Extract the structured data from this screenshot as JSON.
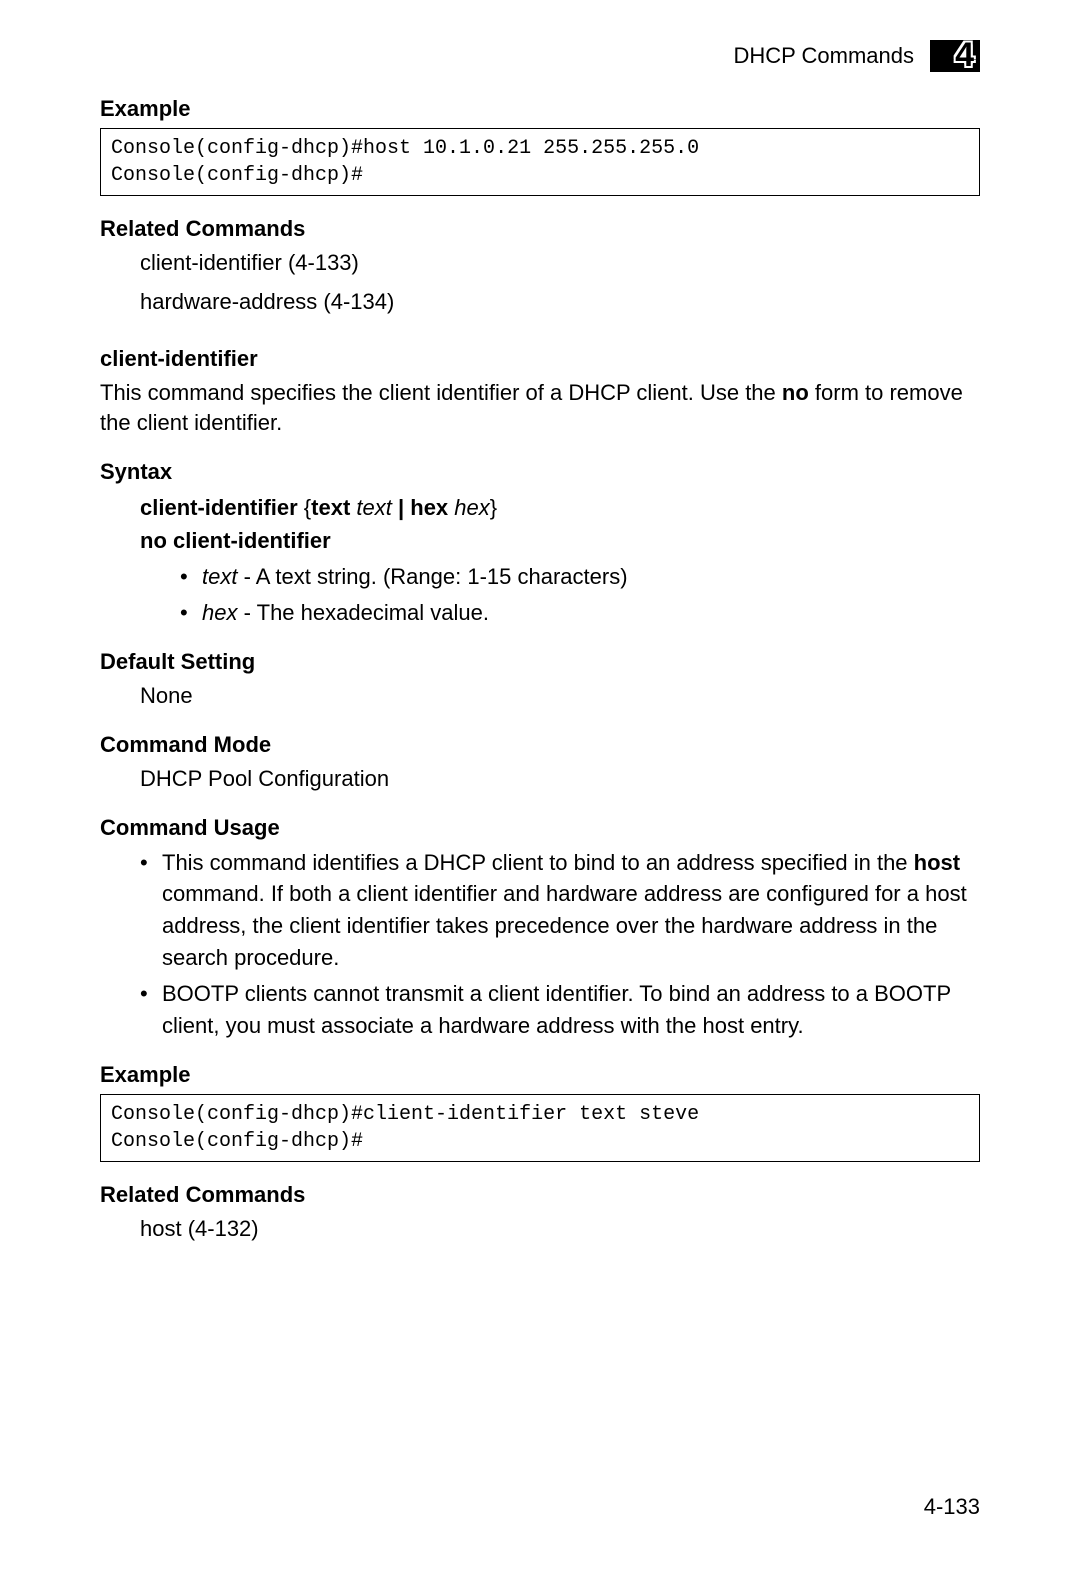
{
  "header": {
    "title": "DHCP Commands",
    "chapter": "4"
  },
  "sections": {
    "example1_heading": "Example",
    "example1_code": "Console(config-dhcp)#host 10.1.0.21 255.255.255.0\nConsole(config-dhcp)#",
    "related1_heading": "Related Commands",
    "related1_line1": "client-identifier (4-133)",
    "related1_line2": "hardware-address (4-134)",
    "cmd_name": "client-identifier",
    "cmd_desc_pre": "This command specifies the client identifier of a DHCP client. Use the ",
    "cmd_desc_bold": "no",
    "cmd_desc_post": " form to remove the client identifier.",
    "syntax_heading": "Syntax",
    "syntax_line1_bold1": "client-identifier",
    "syntax_line1_brace_open": " {",
    "syntax_line1_bold2": "text",
    "syntax_line1_ital1": " text",
    "syntax_line1_bar": " | ",
    "syntax_line1_bold3": "hex",
    "syntax_line1_ital2": " hex",
    "syntax_line1_brace_close": "}",
    "syntax_line2_bold": "no client-identifier",
    "syntax_bullet1_ital": "text",
    "syntax_bullet1_rest": " - A text string. (Range: 1-15 characters)",
    "syntax_bullet2_ital": "hex",
    "syntax_bullet2_rest": " - The hexadecimal value.",
    "default_heading": "Default Setting",
    "default_value": "None",
    "mode_heading": "Command Mode",
    "mode_value": "DHCP Pool Configuration",
    "usage_heading": "Command Usage",
    "usage_b1_pre": "This command identifies a DHCP client to bind to an address specified in the ",
    "usage_b1_bold": "host",
    "usage_b1_post": " command. If both a client identifier and hardware address are configured for a host address, the client identifier takes precedence over the hardware address in the search procedure.",
    "usage_b2": "BOOTP clients cannot transmit a client identifier. To bind an address to a BOOTP client, you must associate a hardware address with the host entry.",
    "example2_heading": "Example",
    "example2_code": "Console(config-dhcp)#client-identifier text steve\nConsole(config-dhcp)#",
    "related2_heading": "Related Commands",
    "related2_line1": "host (4-132)"
  },
  "page_number": "4-133"
}
